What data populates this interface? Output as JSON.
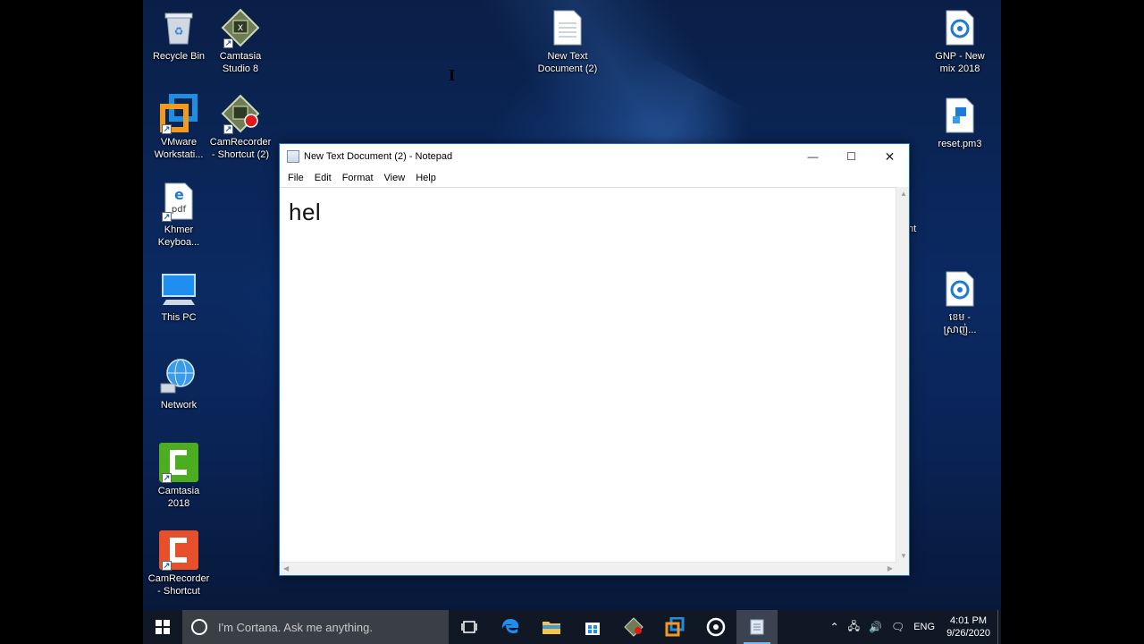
{
  "desktop_icons": {
    "recycle_bin": "Recycle Bin",
    "camtasia8": "Camtasia\nStudio 8",
    "vmware": "VMware\nWorkstati...",
    "camrecorder2": "CamRecorder\n- Shortcut (2)",
    "khmer": "Khmer\nKeyboa...",
    "this_pc": "This PC",
    "network": "Network",
    "camtasia2018": "Camtasia\n2018",
    "camrecorder": "CamRecorder\n- Shortcut",
    "newtext2": "New Text\nDocument (2)",
    "gnp": "GNP - New\nmix 2018",
    "reset": "reset.pm3",
    "khmer_audio": "ខេម -\nស្រាញ់...",
    "partial": "nt"
  },
  "notepad": {
    "title": "New Text Document (2) - Notepad",
    "menu": [
      "File",
      "Edit",
      "Format",
      "View",
      "Help"
    ],
    "content": "hel",
    "controls": {
      "minimize": "—",
      "maximize": "☐",
      "close": "✕"
    }
  },
  "taskbar": {
    "cortana_placeholder": "I'm Cortana. Ask me anything.",
    "language": "ENG",
    "time": "4:01 PM",
    "date": "9/26/2020"
  },
  "colors": {
    "accent": "#1b6dc4",
    "taskbar": "#101826",
    "running_indicator": "#76b9ed"
  }
}
